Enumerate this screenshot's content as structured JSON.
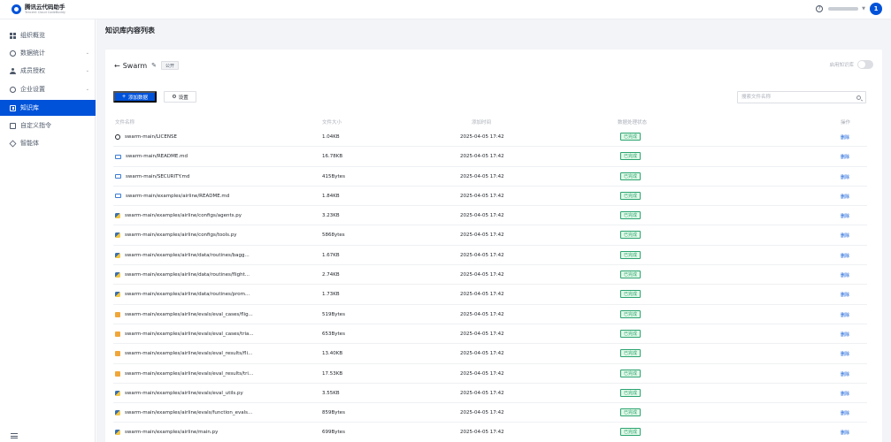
{
  "header": {
    "logo_title": "腾讯云代码助手",
    "logo_subtitle": "Tencent Cloud CodeBuddy",
    "help_icon": "?",
    "avatar_text": "1"
  },
  "sidebar": {
    "items": [
      {
        "label": "组织概览",
        "icon": "grid-icon",
        "has_arrow": false,
        "active": false
      },
      {
        "label": "数据统计",
        "icon": "chart-icon",
        "has_arrow": true,
        "active": false
      },
      {
        "label": "成员授权",
        "icon": "person-icon",
        "has_arrow": true,
        "active": false
      },
      {
        "label": "企业设置",
        "icon": "gear-icon",
        "has_arrow": true,
        "active": false
      },
      {
        "label": "知识库",
        "icon": "book-icon",
        "has_arrow": false,
        "active": true
      },
      {
        "label": "自定义指令",
        "icon": "command-icon",
        "has_arrow": false,
        "active": false
      },
      {
        "label": "智能体",
        "icon": "agent-icon",
        "has_arrow": false,
        "active": false
      }
    ],
    "accent_color": "#0052d9"
  },
  "main": {
    "page_title": "知识库内容列表",
    "kb": {
      "back": "←",
      "name": "Swarm",
      "edit_icon": "✎",
      "badge": "公开",
      "share_label": "启用知识库"
    },
    "toolbar": {
      "add_label": "添加数据",
      "settings_label": "设置",
      "search_placeholder": "搜索文件名称"
    },
    "table": {
      "columns": [
        "文件名称",
        "文件大小",
        "添加时间",
        "数据处理状态",
        "操作"
      ],
      "rows": [
        {
          "icon": "gear",
          "name": "swarm-main/LICENSE",
          "size": "1.04KB",
          "time": "2025-04-05 17:42",
          "status": "已完成",
          "action": "删除"
        },
        {
          "icon": "md",
          "name": "swarm-main/README.md",
          "size": "16.78KB",
          "time": "2025-04-05 17:42",
          "status": "已完成",
          "action": "删除"
        },
        {
          "icon": "md",
          "name": "swarm-main/SECURITY.md",
          "size": "415Bytes",
          "time": "2025-04-05 17:42",
          "status": "已完成",
          "action": "删除"
        },
        {
          "icon": "md",
          "name": "swarm-main/examples/airline/README.md",
          "size": "1.84KB",
          "time": "2025-04-05 17:42",
          "status": "已完成",
          "action": "删除"
        },
        {
          "icon": "py",
          "name": "swarm-main/examples/airline/configs/agents.py",
          "size": "3.23KB",
          "time": "2025-04-05 17:42",
          "status": "已完成",
          "action": "删除"
        },
        {
          "icon": "py",
          "name": "swarm-main/examples/airline/configs/tools.py",
          "size": "5868ytes",
          "time": "2025-04-05 17:42",
          "status": "已完成",
          "action": "删除"
        },
        {
          "icon": "py",
          "name": "swarm-main/examples/airline/data/routines/bagg...",
          "size": "1.67KB",
          "time": "2025-04-05 17:42",
          "status": "已完成",
          "action": "删除"
        },
        {
          "icon": "py",
          "name": "swarm-main/examples/airline/data/routines/flight...",
          "size": "2.74KB",
          "time": "2025-04-05 17:42",
          "status": "已完成",
          "action": "删除"
        },
        {
          "icon": "py",
          "name": "swarm-main/examples/airline/data/routines/prom...",
          "size": "1.73KB",
          "time": "2025-04-05 17:42",
          "status": "已完成",
          "action": "删除"
        },
        {
          "icon": "json",
          "name": "swarm-main/examples/airline/evals/eval_cases/flig...",
          "size": "519Bytes",
          "time": "2025-04-05 17:42",
          "status": "已完成",
          "action": "删除"
        },
        {
          "icon": "json",
          "name": "swarm-main/examples/airline/evals/eval_cases/tria...",
          "size": "653Bytes",
          "time": "2025-04-05 17:42",
          "status": "已完成",
          "action": "删除"
        },
        {
          "icon": "json",
          "name": "swarm-main/examples/airline/evals/eval_results/fli...",
          "size": "13.40KB",
          "time": "2025-04-05 17:42",
          "status": "已完成",
          "action": "删除"
        },
        {
          "icon": "json",
          "name": "swarm-main/examples/airline/evals/eval_results/tri...",
          "size": "17.53KB",
          "time": "2025-04-05 17:42",
          "status": "已完成",
          "action": "删除"
        },
        {
          "icon": "py",
          "name": "swarm-main/examples/airline/evals/eval_utils.py",
          "size": "3.55KB",
          "time": "2025-04-05 17:42",
          "status": "已完成",
          "action": "删除"
        },
        {
          "icon": "py",
          "name": "swarm-main/examples/airline/evals/function_evals...",
          "size": "859Bytes",
          "time": "2025-04-05 17:42",
          "status": "已完成",
          "action": "删除"
        },
        {
          "icon": "py",
          "name": "swarm-main/examples/airline/main.py",
          "size": "699Bytes",
          "time": "2025-04-05 17:42",
          "status": "已完成",
          "action": "删除"
        }
      ]
    }
  }
}
